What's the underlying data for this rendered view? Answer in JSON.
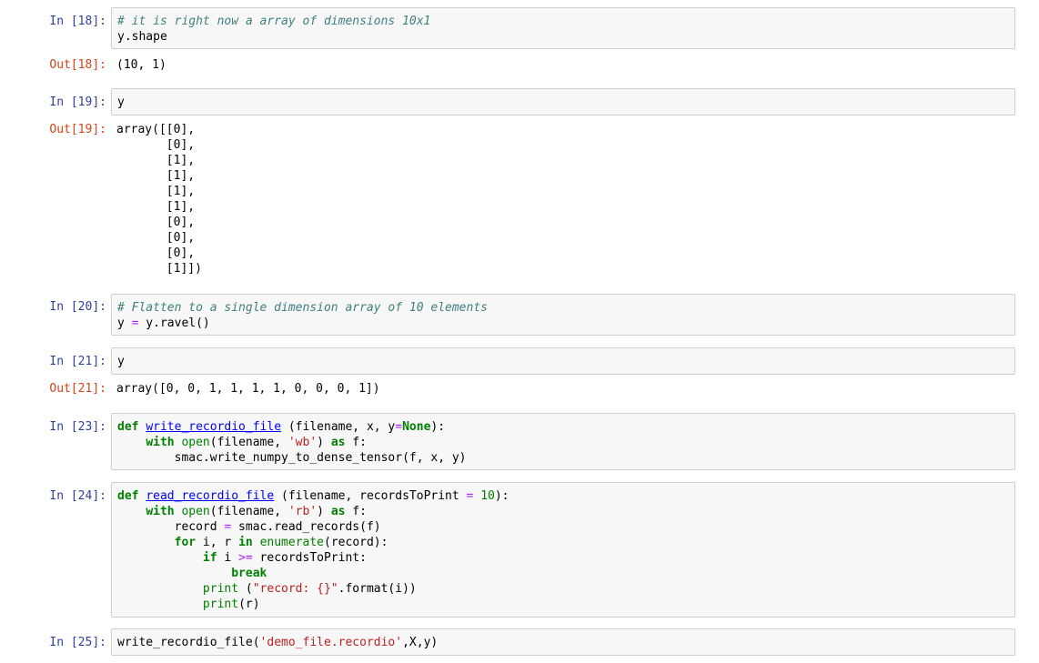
{
  "cells": [
    {
      "in_prompt": "In [18]:",
      "code": [
        [
          {
            "t": "# it is right now a array of dimensions 10x1",
            "c": "cm"
          }
        ],
        [
          {
            "t": "y.shape",
            "c": ""
          }
        ]
      ],
      "out_prompt": "Out[18]:",
      "output": "(10, 1)"
    },
    {
      "in_prompt": "In [19]:",
      "code": [
        [
          {
            "t": "y",
            "c": ""
          }
        ]
      ],
      "out_prompt": "Out[19]:",
      "output": "array([[0],\n       [0],\n       [1],\n       [1],\n       [1],\n       [1],\n       [0],\n       [0],\n       [0],\n       [1]])"
    },
    {
      "in_prompt": "In [20]:",
      "code": [
        [
          {
            "t": "# Flatten to a single dimension array of 10 elements",
            "c": "cm"
          }
        ],
        [
          {
            "t": "y ",
            "c": ""
          },
          {
            "t": "=",
            "c": "op"
          },
          {
            "t": " y.ravel()",
            "c": ""
          }
        ]
      ]
    },
    {
      "in_prompt": "In [21]:",
      "code": [
        [
          {
            "t": "y",
            "c": ""
          }
        ]
      ],
      "out_prompt": "Out[21]:",
      "output": "array([0, 0, 1, 1, 1, 1, 0, 0, 0, 1])"
    },
    {
      "in_prompt": "In [23]:",
      "code": [
        [
          {
            "t": "def",
            "c": "kw"
          },
          {
            "t": " ",
            "c": ""
          },
          {
            "t": "write_recordio_file",
            "c": "fn"
          },
          {
            "t": " (filename, x, y",
            "c": ""
          },
          {
            "t": "=",
            "c": "op"
          },
          {
            "t": "None",
            "c": "kc"
          },
          {
            "t": "):",
            "c": ""
          }
        ],
        [
          {
            "t": "    ",
            "c": ""
          },
          {
            "t": "with",
            "c": "kw"
          },
          {
            "t": " ",
            "c": ""
          },
          {
            "t": "open",
            "c": "bi"
          },
          {
            "t": "(filename, ",
            "c": ""
          },
          {
            "t": "'wb'",
            "c": "st"
          },
          {
            "t": ") ",
            "c": ""
          },
          {
            "t": "as",
            "c": "kw"
          },
          {
            "t": " f:",
            "c": ""
          }
        ],
        [
          {
            "t": "        smac.write_numpy_to_dense_tensor(f, x, y)",
            "c": ""
          }
        ]
      ]
    },
    {
      "in_prompt": "In [24]:",
      "code": [
        [
          {
            "t": "def",
            "c": "kw"
          },
          {
            "t": " ",
            "c": ""
          },
          {
            "t": "read_recordio_file",
            "c": "fn"
          },
          {
            "t": " (filename, recordsToPrint ",
            "c": ""
          },
          {
            "t": "=",
            "c": "op"
          },
          {
            "t": " ",
            "c": ""
          },
          {
            "t": "10",
            "c": "nu"
          },
          {
            "t": "):",
            "c": ""
          }
        ],
        [
          {
            "t": "    ",
            "c": ""
          },
          {
            "t": "with",
            "c": "kw"
          },
          {
            "t": " ",
            "c": ""
          },
          {
            "t": "open",
            "c": "bi"
          },
          {
            "t": "(filename, ",
            "c": ""
          },
          {
            "t": "'rb'",
            "c": "st"
          },
          {
            "t": ") ",
            "c": ""
          },
          {
            "t": "as",
            "c": "kw"
          },
          {
            "t": " f:",
            "c": ""
          }
        ],
        [
          {
            "t": "        record ",
            "c": ""
          },
          {
            "t": "=",
            "c": "op"
          },
          {
            "t": " smac.read_records(f)",
            "c": ""
          }
        ],
        [
          {
            "t": "        ",
            "c": ""
          },
          {
            "t": "for",
            "c": "kw"
          },
          {
            "t": " i, r ",
            "c": ""
          },
          {
            "t": "in",
            "c": "kw"
          },
          {
            "t": " ",
            "c": ""
          },
          {
            "t": "enumerate",
            "c": "bi"
          },
          {
            "t": "(record):",
            "c": ""
          }
        ],
        [
          {
            "t": "            ",
            "c": ""
          },
          {
            "t": "if",
            "c": "kw"
          },
          {
            "t": " i ",
            "c": ""
          },
          {
            "t": ">=",
            "c": "op"
          },
          {
            "t": " recordsToPrint:",
            "c": ""
          }
        ],
        [
          {
            "t": "                ",
            "c": ""
          },
          {
            "t": "break",
            "c": "kw"
          }
        ],
        [
          {
            "t": "            ",
            "c": ""
          },
          {
            "t": "print",
            "c": "bi"
          },
          {
            "t": " (",
            "c": ""
          },
          {
            "t": "\"record: {}\"",
            "c": "st"
          },
          {
            "t": ".format(i))",
            "c": ""
          }
        ],
        [
          {
            "t": "            ",
            "c": ""
          },
          {
            "t": "print",
            "c": "bi"
          },
          {
            "t": "(r)",
            "c": ""
          }
        ]
      ]
    },
    {
      "in_prompt": "In [25]:",
      "code": [
        [
          {
            "t": "write_recordio_file(",
            "c": ""
          },
          {
            "t": "'demo_file.recordio'",
            "c": "st"
          },
          {
            "t": ",X,y)",
            "c": ""
          }
        ]
      ]
    }
  ]
}
